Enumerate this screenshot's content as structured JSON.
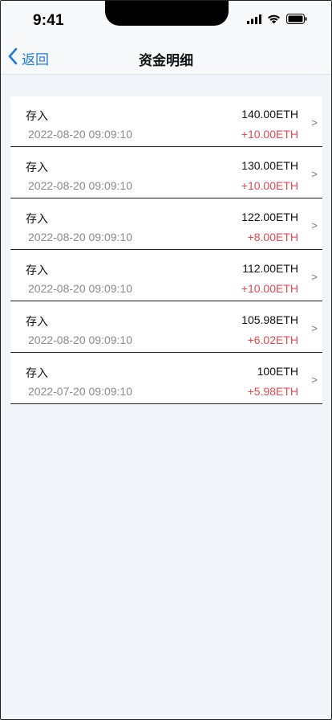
{
  "status_bar": {
    "time": "9:41",
    "icons": [
      "signal-icon",
      "wifi-icon",
      "battery-icon"
    ]
  },
  "nav": {
    "back_label": "返回",
    "title": "资金明细"
  },
  "colors": {
    "accent": "#1f7ae0",
    "positive_change": "#e5484d",
    "date_text": "#8a8a8a",
    "background": "#f1f4f8"
  },
  "records": [
    {
      "type": "存入",
      "amount": "140.00ETH",
      "date": "2022-08-20 09:09:10",
      "change": "+10.00ETH",
      "chevron": ">"
    },
    {
      "type": "存入",
      "amount": "130.00ETH",
      "date": "2022-08-20 09:09:10",
      "change": "+10.00ETH",
      "chevron": ">"
    },
    {
      "type": "存入",
      "amount": "122.00ETH",
      "date": "2022-08-20 09:09:10",
      "change": "+8.00ETH",
      "chevron": ">"
    },
    {
      "type": "存入",
      "amount": "112.00ETH",
      "date": "2022-08-20 09:09:10",
      "change": "+10.00ETH",
      "chevron": ">"
    },
    {
      "type": "存入",
      "amount": "105.98ETH",
      "date": "2022-08-20 09:09:10",
      "change": "+6.02ETH",
      "chevron": ">"
    },
    {
      "type": "存入",
      "amount": "100ETH",
      "date": "2022-07-20 09:09:10",
      "change": "+5.98ETH",
      "chevron": ">"
    }
  ]
}
